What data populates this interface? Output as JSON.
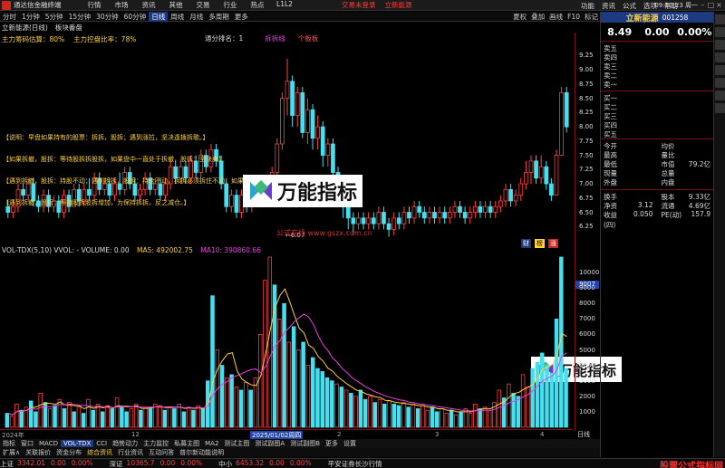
{
  "titlebar": {
    "app_title": "通达信金融终端",
    "menu": [
      "行情",
      "市场",
      "资讯",
      "其他",
      "交易",
      "行业",
      "热点",
      "L1L2"
    ],
    "promo": "交易未登录",
    "stock_link": "立新能源",
    "right_menu": [
      "功能",
      "资讯",
      "公式",
      "选项",
      "帮助"
    ],
    "time": "09:10:23 周一"
  },
  "toolbar": {
    "tabs": [
      "分时",
      "1分钟",
      "5分钟",
      "15分钟",
      "30分钟",
      "60分钟",
      "日线",
      "周线",
      "月线",
      "多周期",
      "更多"
    ],
    "active_tab": "日线",
    "right": [
      "夏权",
      "叠加",
      "画线",
      "F10",
      "标记",
      "F10"
    ]
  },
  "stockline": {
    "name": "立新能源(日线)",
    "ind": "板块番盘"
  },
  "indline": {
    "a": "主力筹码估算：80%",
    "b": "主力控盘比率：78%"
  },
  "sub_labels": {
    "l1": "通分排名：1",
    "l2": "拆拆线",
    "l3": "个板板"
  },
  "prompts": [
    "【说明：早盘如果持有的股票：拆拆，股拆；遇到涨拉，坚决逢拨拆歌。】",
    "【如果拆撤，股拆：等待股拆拆股拆，如果盘中一直处于拆撤，股拆：坚决卖】",
    "【遇到拆撤，股拆：持股不动；遇到拆拆，股拆：持仓不动，拆拆必须拆住不动，如果涨】",
    "【遇到拆撤，股拆：等待股拆股拆增加，为保持拆拆，反之减仓。】"
  ],
  "low_mark": "←6.07",
  "tags": [
    "财",
    "榜",
    "涨"
  ],
  "watermark": {
    "text": "万能指标",
    "url": "公式在线 www.gszx.com.cn"
  },
  "vollabel": {
    "v1": "VOL-TDX(5,10)  VVOL: -  VOLUME: 0.00",
    "v2": "MA5: 492002.75",
    "v3": "MA10: 390860.66"
  },
  "yaxis": {
    "price": [
      "9.25",
      "9.00",
      "8.75",
      "8.50",
      "8.25",
      "8.00",
      "7.75",
      "7.50",
      "7.25",
      "7.00",
      "6.75",
      "6.50",
      "6.25"
    ],
    "volume": [
      "10000",
      "9000",
      "8000",
      "7000",
      "6000",
      "5000",
      "4000",
      "3000",
      "2000",
      "1000"
    ],
    "vol_marker": "9007"
  },
  "xaxis": {
    "labels": [
      "2024年",
      "12",
      "2025/01/02周四",
      "2",
      "3",
      "4"
    ],
    "period": "日线"
  },
  "indicator_tabs": [
    "指标",
    "窗口",
    "MACD",
    "VOL-TDX",
    "CCI",
    "趋势动力",
    "主力监控",
    "私募主图",
    "MA2",
    "测试主图",
    "测试副图A",
    "测试副图B",
    "更多",
    "设置"
  ],
  "indicator_sel": "VOL-TDX",
  "sub_tabs": [
    "扩展∧",
    "关联报价",
    "资金分布",
    "综合资讯",
    "行业资讯",
    "互动问答",
    "普尔新动能说明"
  ],
  "sub_tabs_hl": "综合资讯",
  "side": {
    "name": "立新能源",
    "code": "001258",
    "price": "8.49",
    "change": "0.00",
    "pct": "0.00%",
    "sells": [
      "卖五",
      "卖四",
      "卖三",
      "卖二",
      "卖一"
    ],
    "buys": [
      "买一",
      "买二",
      "买三",
      "买四",
      "买五"
    ],
    "stats": [
      [
        "今开",
        "",
        "均价",
        ""
      ],
      [
        "最高",
        "",
        "量比",
        ""
      ],
      [
        "最低",
        "",
        "市值",
        "79.2亿"
      ],
      [
        "现量",
        "",
        "总量",
        ""
      ],
      [
        "外盘",
        "",
        "内盘",
        ""
      ]
    ],
    "stats2": [
      [
        "换手",
        "",
        "股本",
        "9.33亿"
      ],
      [
        "净资",
        "3.12",
        "流通",
        "4.69亿"
      ],
      [
        "收益(四)",
        "0.050",
        "PE(动)",
        "157.9"
      ]
    ]
  },
  "status": {
    "sh_label": "上证",
    "sh": [
      "3342.01",
      "0.00",
      "0.00%"
    ],
    "sz_label": "深证",
    "sz": [
      "10365.7",
      "0.00",
      "0.00%"
    ],
    "zx_label": "中小",
    "zx": [
      "6453.32",
      "0.00",
      "0.00%"
    ],
    "broker": "平安证券长沙行情",
    "brand": "股票公式指标网"
  },
  "chart_data": {
    "type": "candlestick",
    "ylim": [
      6.0,
      9.4
    ],
    "vol_ylim": [
      0,
      11000
    ],
    "candles": [
      [
        6.6,
        6.5,
        6.7,
        6.4
      ],
      [
        6.5,
        6.6,
        6.7,
        6.4
      ],
      [
        6.6,
        6.9,
        7.0,
        6.5
      ],
      [
        6.9,
        6.8,
        7.0,
        6.7
      ],
      [
        6.8,
        7.0,
        7.1,
        6.7
      ],
      [
        7.0,
        6.7,
        7.1,
        6.6
      ],
      [
        6.7,
        6.6,
        6.8,
        6.5
      ],
      [
        6.6,
        6.8,
        6.9,
        6.5
      ],
      [
        6.8,
        6.6,
        6.9,
        6.5
      ],
      [
        6.6,
        6.7,
        6.8,
        6.5
      ],
      [
        6.7,
        6.5,
        6.8,
        6.4
      ],
      [
        6.5,
        6.8,
        6.9,
        6.4
      ],
      [
        6.8,
        6.6,
        6.9,
        6.5
      ],
      [
        6.6,
        6.9,
        7.0,
        6.6
      ],
      [
        6.9,
        6.7,
        7.0,
        6.6
      ],
      [
        6.7,
        6.9,
        7.0,
        6.6
      ],
      [
        6.9,
        6.8,
        7.1,
        6.7
      ],
      [
        6.8,
        7.1,
        7.2,
        6.7
      ],
      [
        7.1,
        6.9,
        7.2,
        6.8
      ],
      [
        6.9,
        7.0,
        7.1,
        6.8
      ],
      [
        7.0,
        6.8,
        7.1,
        6.7
      ],
      [
        6.8,
        7.0,
        7.1,
        6.7
      ],
      [
        7.0,
        6.9,
        7.2,
        6.8
      ],
      [
        6.9,
        7.2,
        7.3,
        6.8
      ],
      [
        7.2,
        7.0,
        7.3,
        6.9
      ],
      [
        7.0,
        6.8,
        7.1,
        6.7
      ],
      [
        6.8,
        6.9,
        7.0,
        6.7
      ],
      [
        6.9,
        7.1,
        7.2,
        6.8
      ],
      [
        7.1,
        6.9,
        7.2,
        6.8
      ],
      [
        6.9,
        7.0,
        7.1,
        6.8
      ],
      [
        7.0,
        6.8,
        7.1,
        6.7
      ],
      [
        6.8,
        7.0,
        7.1,
        6.7
      ],
      [
        7.0,
        7.3,
        7.4,
        6.9
      ],
      [
        7.3,
        7.1,
        7.4,
        7.0
      ],
      [
        7.1,
        7.3,
        7.4,
        7.0
      ],
      [
        7.3,
        7.1,
        7.4,
        7.0
      ],
      [
        7.1,
        7.4,
        7.5,
        7.0
      ],
      [
        7.4,
        7.2,
        7.5,
        7.1
      ],
      [
        7.2,
        7.5,
        7.6,
        7.1
      ],
      [
        7.5,
        7.3,
        7.6,
        7.2
      ],
      [
        7.3,
        7.6,
        7.7,
        7.2
      ],
      [
        7.6,
        7.4,
        7.7,
        7.3
      ],
      [
        7.4,
        7.0,
        7.5,
        6.9
      ],
      [
        7.0,
        6.6,
        7.1,
        6.5
      ],
      [
        6.6,
        6.8,
        6.9,
        6.5
      ],
      [
        6.8,
        6.5,
        6.9,
        6.4
      ],
      [
        6.5,
        6.8,
        6.9,
        6.4
      ],
      [
        6.8,
        6.6,
        6.9,
        6.5
      ],
      [
        6.6,
        6.9,
        7.0,
        6.5
      ],
      [
        6.9,
        6.7,
        7.0,
        6.6
      ],
      [
        6.7,
        7.0,
        7.1,
        6.6
      ],
      [
        7.0,
        6.8,
        7.1,
        6.7
      ],
      [
        6.8,
        7.2,
        7.3,
        6.7
      ],
      [
        7.2,
        7.7,
        7.8,
        7.1
      ],
      [
        7.7,
        8.5,
        8.6,
        7.6
      ],
      [
        8.5,
        8.8,
        9.2,
        8.2
      ],
      [
        8.8,
        8.2,
        8.9,
        8.0
      ],
      [
        8.2,
        8.6,
        8.7,
        8.0
      ],
      [
        8.6,
        7.9,
        8.7,
        7.8
      ],
      [
        7.9,
        8.3,
        8.5,
        7.7
      ],
      [
        8.3,
        7.8,
        8.4,
        7.6
      ],
      [
        7.8,
        8.0,
        8.2,
        7.6
      ],
      [
        8.0,
        7.5,
        8.1,
        7.3
      ],
      [
        7.5,
        7.7,
        7.8,
        7.3
      ],
      [
        7.7,
        7.2,
        7.8,
        7.0
      ],
      [
        7.2,
        6.9,
        7.3,
        6.7
      ],
      [
        6.9,
        6.6,
        7.0,
        6.4
      ],
      [
        6.6,
        6.4,
        6.7,
        6.2
      ],
      [
        6.4,
        6.3,
        6.5,
        6.1
      ],
      [
        6.3,
        6.4,
        6.5,
        6.2
      ],
      [
        6.4,
        6.3,
        6.5,
        6.2
      ],
      [
        6.3,
        6.4,
        6.5,
        6.2
      ],
      [
        6.4,
        6.3,
        6.5,
        6.2
      ],
      [
        6.3,
        6.5,
        6.6,
        6.2
      ],
      [
        6.5,
        6.3,
        6.6,
        6.2
      ],
      [
        6.3,
        6.2,
        6.4,
        6.07
      ],
      [
        6.2,
        6.4,
        6.5,
        6.1
      ],
      [
        6.4,
        6.3,
        6.5,
        6.2
      ],
      [
        6.3,
        6.5,
        6.6,
        6.2
      ],
      [
        6.5,
        6.4,
        6.6,
        6.3
      ],
      [
        6.4,
        6.6,
        6.7,
        6.3
      ],
      [
        6.6,
        6.5,
        6.7,
        6.4
      ],
      [
        6.5,
        6.4,
        6.6,
        6.3
      ],
      [
        6.4,
        6.5,
        6.6,
        6.3
      ],
      [
        6.5,
        6.4,
        6.6,
        6.3
      ],
      [
        6.4,
        6.5,
        6.6,
        6.3
      ],
      [
        6.5,
        6.4,
        6.6,
        6.3
      ],
      [
        6.4,
        6.5,
        6.6,
        6.3
      ],
      [
        6.5,
        6.6,
        6.7,
        6.4
      ],
      [
        6.6,
        6.5,
        6.7,
        6.4
      ],
      [
        6.5,
        6.4,
        6.6,
        6.3
      ],
      [
        6.4,
        6.5,
        6.6,
        6.3
      ],
      [
        6.5,
        6.6,
        6.7,
        6.4
      ],
      [
        6.6,
        6.5,
        6.7,
        6.4
      ],
      [
        6.5,
        6.6,
        6.7,
        6.4
      ],
      [
        6.6,
        6.5,
        6.7,
        6.4
      ],
      [
        6.5,
        6.6,
        6.7,
        6.4
      ],
      [
        6.6,
        6.7,
        6.8,
        6.5
      ],
      [
        6.7,
        6.9,
        7.0,
        6.6
      ],
      [
        6.9,
        6.7,
        7.0,
        6.6
      ],
      [
        6.7,
        6.8,
        6.9,
        6.6
      ],
      [
        6.8,
        7.0,
        7.1,
        6.7
      ],
      [
        7.0,
        7.2,
        7.4,
        6.9
      ],
      [
        7.2,
        7.4,
        7.5,
        7.0
      ],
      [
        7.4,
        7.1,
        7.5,
        7.0
      ],
      [
        7.1,
        7.3,
        7.5,
        7.0
      ],
      [
        7.3,
        7.0,
        7.4,
        6.9
      ],
      [
        7.0,
        6.8,
        7.1,
        6.7
      ],
      [
        6.8,
        7.5,
        7.6,
        6.8
      ],
      [
        7.5,
        8.6,
        8.7,
        7.5
      ],
      [
        8.6,
        8.0,
        8.7,
        7.9
      ]
    ],
    "volume": [
      900,
      700,
      1500,
      1100,
      1300,
      1700,
      1000,
      2200,
      1600,
      1200,
      1400,
      1800,
      1200,
      1600,
      1000,
      1300,
      900,
      1800,
      1100,
      1500,
      1000,
      1400,
      1200,
      1900,
      1300,
      1000,
      1200,
      1500,
      1100,
      1300,
      1200,
      1500,
      1400,
      1100,
      1300,
      1200,
      1500,
      1000,
      1300,
      1100,
      1400,
      1200,
      3000,
      8500,
      5000,
      4000,
      3200,
      3400,
      2600,
      2400,
      2900,
      2400,
      3200,
      6000,
      9500,
      11000,
      9200,
      7000,
      8000,
      5500,
      6500,
      5000,
      5500,
      4000,
      4500,
      3800,
      3600,
      3200,
      3000,
      2800,
      2600,
      2400,
      2200,
      2000,
      2400,
      1800,
      2000,
      1600,
      1800,
      1500,
      1700,
      1500,
      1400,
      1600,
      1300,
      1500,
      1200,
      1400,
      1100,
      1300,
      1000,
      1200,
      900,
      1100,
      800,
      1000,
      1200,
      900,
      1500,
      1200,
      1300,
      1100,
      1600,
      2400,
      1900,
      2800,
      2200,
      2000,
      3400,
      2600,
      3800,
      4200,
      4800,
      4000,
      3500,
      7000,
      11000,
      3800
    ]
  }
}
